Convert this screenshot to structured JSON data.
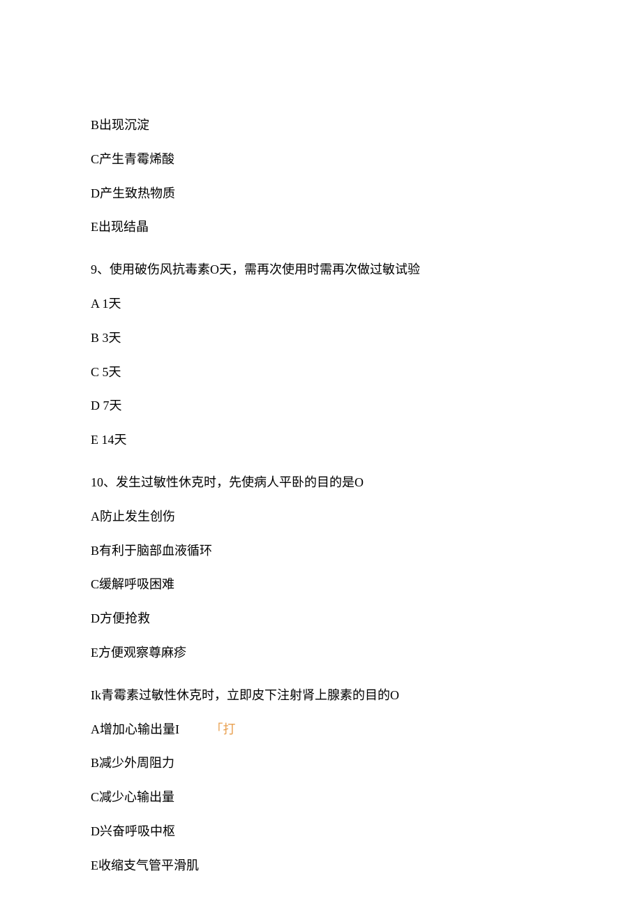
{
  "q8_partial": {
    "optB": "B出现沉淀",
    "optC": "C产生青霉烯酸",
    "optD": "D产生致热物质",
    "optE": "E出现结晶"
  },
  "q9": {
    "question": "9、使用破伤风抗毒素O天，需再次使用时需再次做过敏试验",
    "optA": "A 1天",
    "optB": "B 3天",
    "optC": "C 5天",
    "optD": "D 7天",
    "optE": "E 14天"
  },
  "q10": {
    "question": "10、发生过敏性休克时，先使病人平卧的目的是O",
    "optA": "A防止发生创伤",
    "optB": "B有利于脑部血液循环",
    "optC": "C缓解呼吸困难",
    "optD": "D方便抢救",
    "optE": "E方便观察尊麻疹"
  },
  "q11": {
    "question": "Ik青霉素过敏性休克时，立即皮下注射肾上腺素的目的O",
    "optA": "A增加心输出量I",
    "optA_extra": "「打",
    "optB": "B减少外周阻力",
    "optC": "C减少心输出量",
    "optD": "D兴奋呼吸中枢",
    "optE": "E收缩支气管平滑肌"
  }
}
